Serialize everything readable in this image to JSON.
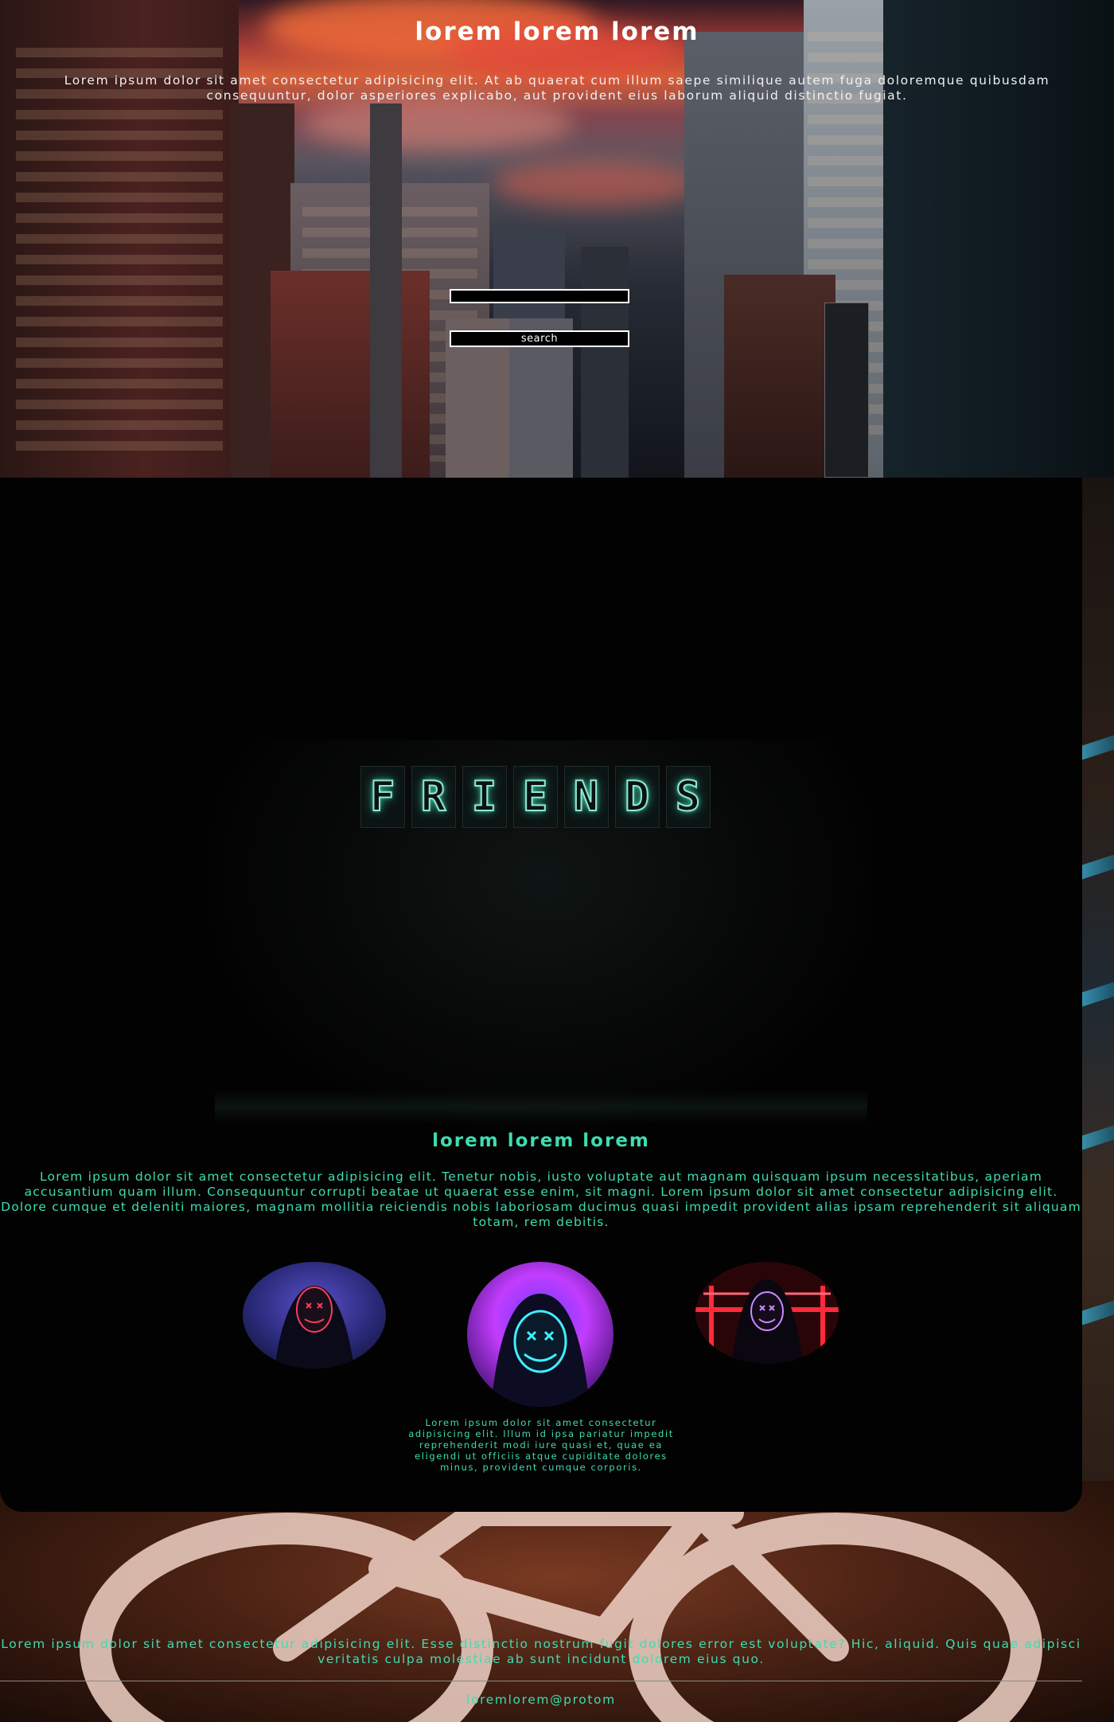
{
  "hero": {
    "title": "lorem lorem lorem",
    "text": "Lorem ipsum dolor sit amet consectetur adipisicing elit. At ab quaerat cum illum saepe similique autem fuga doloremque quibusdam consequuntur, dolor asperiores explicabo, aut provident eius laborum aliquid distinctio fugiat.",
    "search_input_value": "",
    "search_button_label": "search"
  },
  "friends": {
    "sign_letters": [
      "F",
      "R",
      "I",
      "E",
      "N",
      "D",
      "S"
    ],
    "title": "lorem lorem lorem",
    "text": "Lorem ipsum dolor sit amet consectetur adipisicing elit. Tenetur nobis, iusto voluptate aut magnam quisquam ipsum necessitatibus, aperiam accusantium quam illum. Consequuntur corrupti beatae ut quaerat esse enim, sit magni. Lorem ipsum dolor sit amet consectetur adipisicing elit. Dolore cumque et deleniti maiores, magnam mollitia reiciendis nobis laboriosam ducimus quasi impedit provident alias ipsam reprehenderit sit aliquam totam, rem debitis.",
    "caption": "Lorem ipsum dolor sit amet consectetur adipisicing elit. Illum id ipsa pariatur impedit reprehenderit modi iure quasi et, quae ea eligendi ut officiis atque cupiditate dolores minus, provident cumque corporis."
  },
  "footer": {
    "text": "Lorem ipsum dolor sit amet consectetur adipisicing elit. Esse distinctio nostrum fugit dolores error est voluptate? Hic, aliquid. Quis quae adipisci veritatis culpa molestiae ab sunt incidunt dolorem eius quo.",
    "email": "loremlorem@protom"
  },
  "colors": {
    "accent": "#3fdcb0",
    "card_bg": "#020202",
    "neon_sign": "#8fe8d2"
  }
}
